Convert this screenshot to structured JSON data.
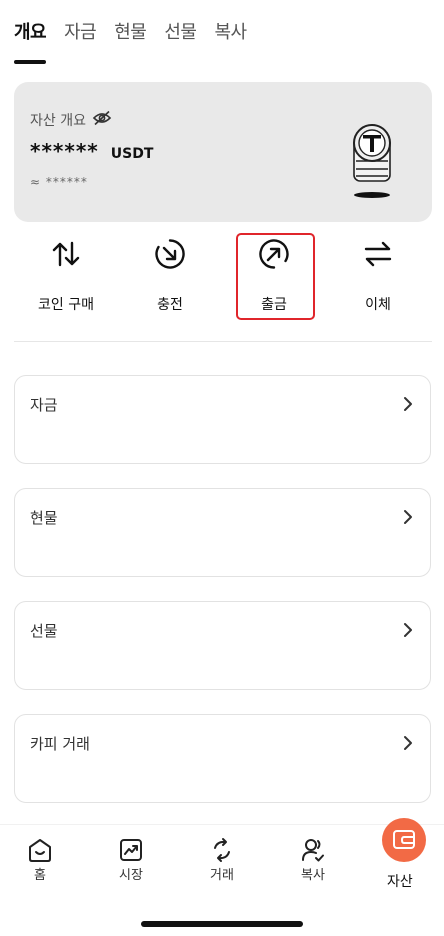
{
  "top_tabs": [
    {
      "label": "개요",
      "active": true
    },
    {
      "label": "자금",
      "active": false
    },
    {
      "label": "현물",
      "active": false
    },
    {
      "label": "선물",
      "active": false
    },
    {
      "label": "복사",
      "active": false
    }
  ],
  "balance": {
    "label": "자산 개요",
    "hidden_amount": "******",
    "unit": "USDT",
    "approx": "≈ ******"
  },
  "actions": [
    {
      "label": "코인 구매",
      "icon": "swap-vertical-icon"
    },
    {
      "label": "충전",
      "icon": "deposit-icon"
    },
    {
      "label": "출금",
      "icon": "withdraw-icon"
    },
    {
      "label": "이체",
      "icon": "transfer-icon"
    }
  ],
  "highlight_color": "#e0252b",
  "accounts": [
    {
      "title": "자금"
    },
    {
      "title": "현물"
    },
    {
      "title": "선물"
    },
    {
      "title": "카피 거래"
    }
  ],
  "bottom_nav": [
    {
      "label": "홈",
      "icon": "home-icon"
    },
    {
      "label": "시장",
      "icon": "chart-icon"
    },
    {
      "label": "거래",
      "icon": "trade-icon"
    },
    {
      "label": "복사",
      "icon": "copy-user-icon"
    },
    {
      "label": "자산",
      "icon": "wallet-icon",
      "active": true
    }
  ],
  "accent_color": "#f26a45"
}
